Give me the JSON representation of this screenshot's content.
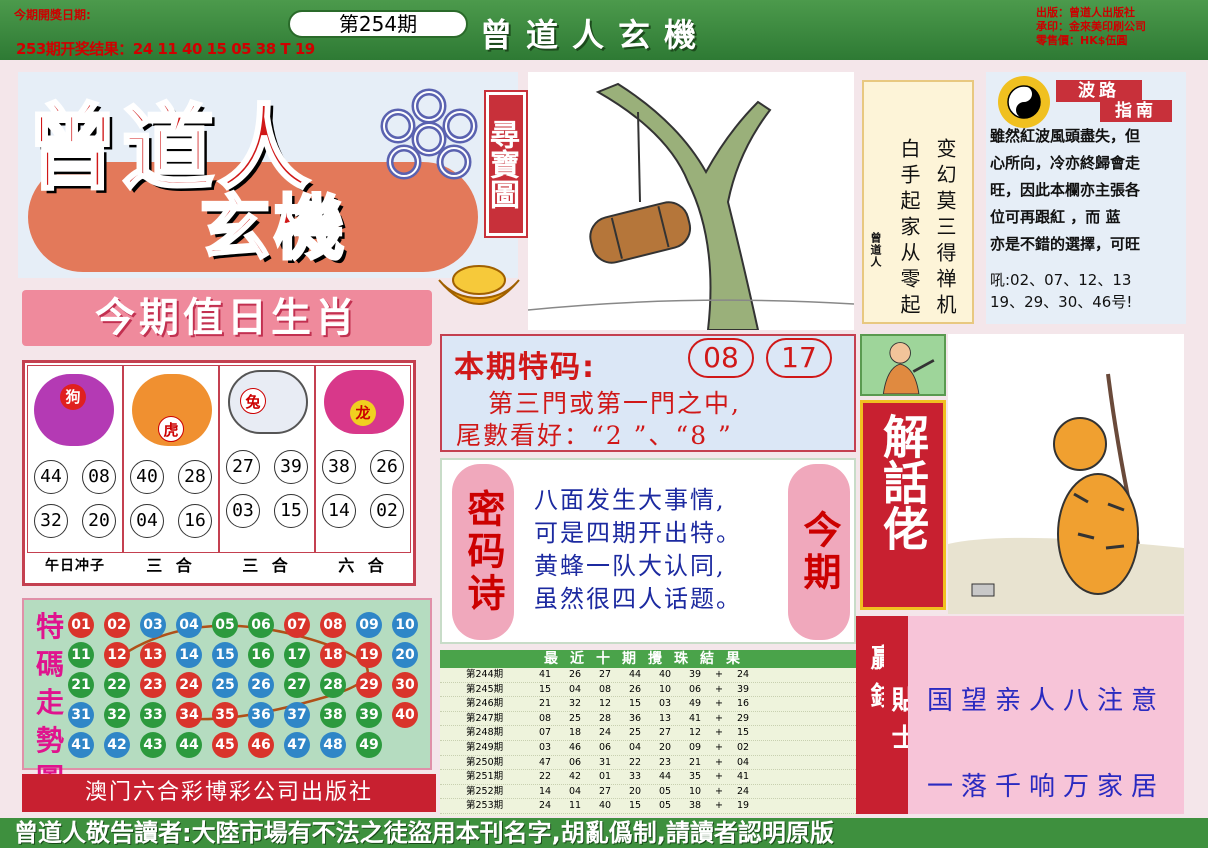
{
  "header": {
    "next_draw_label": "今期開獎日期:",
    "last_result": "253期开奖结果：24 11 40 15 05 38 T 19",
    "issue": "第254期",
    "masthead": "曾道人玄機",
    "publisher_lines": [
      "出版：曾道人出版社",
      "承印：金來美印刷公司",
      "零售價：HK$伍圓"
    ]
  },
  "title": {
    "line1": "曾道人",
    "line2": "玄機",
    "badge": "尋寶圖"
  },
  "zodiac": {
    "banner": "今期值日生肖",
    "cells": [
      {
        "tag": "狗",
        "nums": [
          "44",
          "08",
          "32",
          "20"
        ],
        "label": "午日冲子"
      },
      {
        "tag": "虎",
        "nums": [
          "40",
          "28",
          "04",
          "16"
        ],
        "label": "三 合"
      },
      {
        "tag": "兔",
        "nums": [
          "27",
          "39",
          "03",
          "15"
        ],
        "label": "三 合"
      },
      {
        "tag": "龙",
        "nums": [
          "38",
          "26",
          "14",
          "02"
        ],
        "label": "六 合"
      }
    ]
  },
  "trend": {
    "label_chars": [
      "特",
      "碼",
      "走",
      "勢",
      "圖"
    ],
    "rows": [
      [
        "01",
        "02",
        "03",
        "04",
        "05",
        "06",
        "07",
        "08",
        "09",
        "10"
      ],
      [
        "11",
        "12",
        "13",
        "14",
        "15",
        "16",
        "17",
        "18",
        "19",
        "20"
      ],
      [
        "21",
        "22",
        "23",
        "24",
        "25",
        "26",
        "27",
        "28",
        "29",
        "30"
      ],
      [
        "31",
        "32",
        "33",
        "34",
        "35",
        "36",
        "37",
        "38",
        "39",
        "40"
      ],
      [
        "41",
        "42",
        "43",
        "44",
        "45",
        "46",
        "47",
        "48",
        "49"
      ]
    ],
    "colors": {
      "red": "#d9342b",
      "blue": "#2f86c7",
      "green": "#2c9a3e"
    }
  },
  "publisher_bar": "澳门六合彩博彩公司出版社",
  "poem_column": {
    "lines": [
      "变幻莫三得禅机",
      "白手起家从零起"
    ],
    "signature": "曾道人"
  },
  "guide": {
    "title1": "波路",
    "title2": "指南",
    "lines": [
      "雖然紅波風頭盡失，但",
      "心所向，冷亦終歸會走",
      "旺，因此本欄亦主張各",
      "位可再跟紅 ，而 蓝",
      "亦是不錯的選擇，可旺",
      "吼:02、07、12、13",
      "   19、29、30、46号!"
    ]
  },
  "special": {
    "heading": "本期特码:",
    "codes": [
      "08",
      "17"
    ],
    "line1": "第三門或第一門之中,",
    "line2": "尾數看好：“2 ”、“8 ”"
  },
  "secret_poem": {
    "left_label": "密码诗",
    "right_label": "今期",
    "lines": [
      "八面发生大事情,",
      "可是四期开出特。",
      "黄蜂一队大认同,",
      "虽然很四人话题。"
    ]
  },
  "draws": {
    "heading": "最近十期攪珠結果",
    "rows": [
      [
        "第244期",
        "41",
        "26",
        "27",
        "44",
        "40",
        "39",
        "+",
        "24"
      ],
      [
        "第245期",
        "15",
        "04",
        "08",
        "26",
        "10",
        "06",
        "+",
        "39"
      ],
      [
        "第246期",
        "21",
        "32",
        "12",
        "15",
        "03",
        "49",
        "+",
        "16"
      ],
      [
        "第247期",
        "08",
        "25",
        "28",
        "36",
        "13",
        "41",
        "+",
        "29"
      ],
      [
        "第248期",
        "07",
        "18",
        "24",
        "25",
        "27",
        "12",
        "+",
        "15"
      ],
      [
        "第249期",
        "03",
        "46",
        "06",
        "04",
        "20",
        "09",
        "+",
        "02"
      ],
      [
        "第250期",
        "47",
        "06",
        "31",
        "22",
        "23",
        "21",
        "+",
        "04"
      ],
      [
        "第251期",
        "22",
        "42",
        "01",
        "33",
        "44",
        "35",
        "+",
        "41"
      ],
      [
        "第252期",
        "14",
        "04",
        "27",
        "20",
        "05",
        "10",
        "+",
        "24"
      ],
      [
        "第253期",
        "24",
        "11",
        "40",
        "15",
        "05",
        "38",
        "+",
        "19"
      ]
    ]
  },
  "jiehua": {
    "label": "解話佬"
  },
  "tips": {
    "side_label": "贏錢",
    "label2": "貼士",
    "line1": "国望亲人八注意",
    "line2": "一落千响万家居"
  },
  "footer": "曾道人敬告讀者:大陸市場有不法之徒盜用本刊名字,胡亂僞制,請讀者認明原版"
}
